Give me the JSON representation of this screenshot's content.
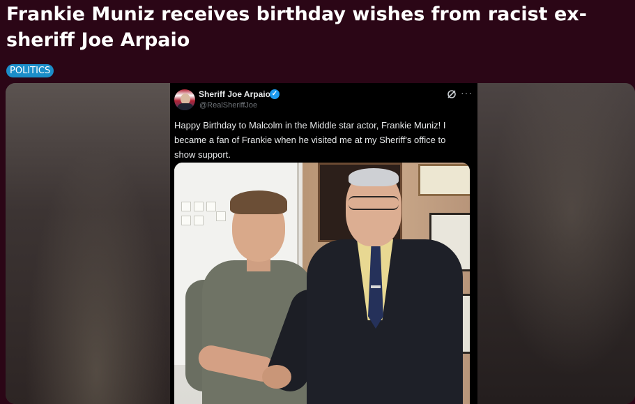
{
  "article": {
    "headline": "Frankie Muniz receives birthday wishes from racist ex-sheriff Joe Arpaio",
    "category": "POLITICS"
  },
  "tweet": {
    "author_name": "Sheriff Joe Arpaio",
    "author_handle": "@RealSheriffJoe",
    "verified": true,
    "text": "Happy Birthday to Malcolm in the Middle star actor, Frankie Muniz! I became a fan of Frankie when he visited me at my Sheriff's office to show support.",
    "icons": {
      "verified": "verified-badge-icon",
      "grok": "grok-icon",
      "more": "more-options-icon"
    },
    "colors": {
      "background": "#000000",
      "verified": "#1d9bf0"
    }
  },
  "theme": {
    "page_background": "#2b0616",
    "tag_background": "#1b8ec9"
  }
}
